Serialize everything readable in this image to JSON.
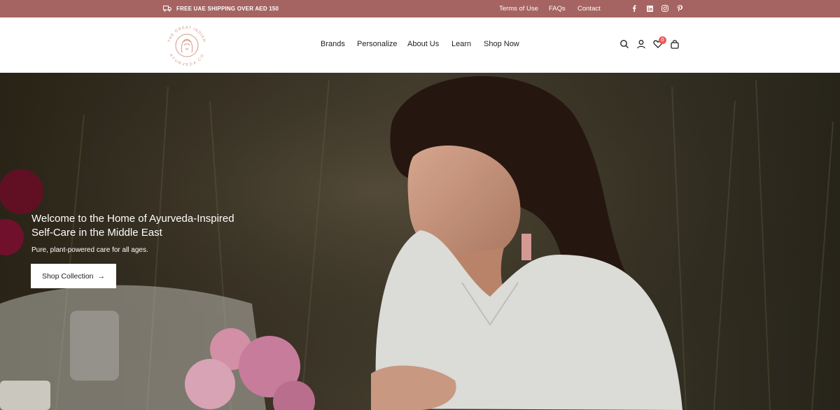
{
  "topbar": {
    "shipping_text": "FREE UAE SHIPPING OVER AED 150",
    "links": [
      "Terms of Use",
      "FAQs",
      "Contact"
    ],
    "social_icons": [
      "facebook-icon",
      "linkedin-icon",
      "instagram-icon",
      "pinterest-icon"
    ],
    "bg_color": "#a56462"
  },
  "header": {
    "logo_text_top": "THE GREAT INDIAN",
    "logo_text_bottom": "AYURVEDA CO",
    "nav": [
      "Brands",
      "Personalize",
      "About Us",
      "Learn",
      "Shop Now"
    ],
    "icons": [
      "search-icon",
      "account-icon",
      "wishlist-icon",
      "cart-icon"
    ],
    "wishlist_count": "0"
  },
  "hero": {
    "title": "Welcome to the Home of Ayurveda-Inspired Self-Care in the Middle East",
    "subtitle": "Pure, plant-powered care for all ages.",
    "cta_label": "Shop Collection",
    "cta_arrow": "→"
  }
}
